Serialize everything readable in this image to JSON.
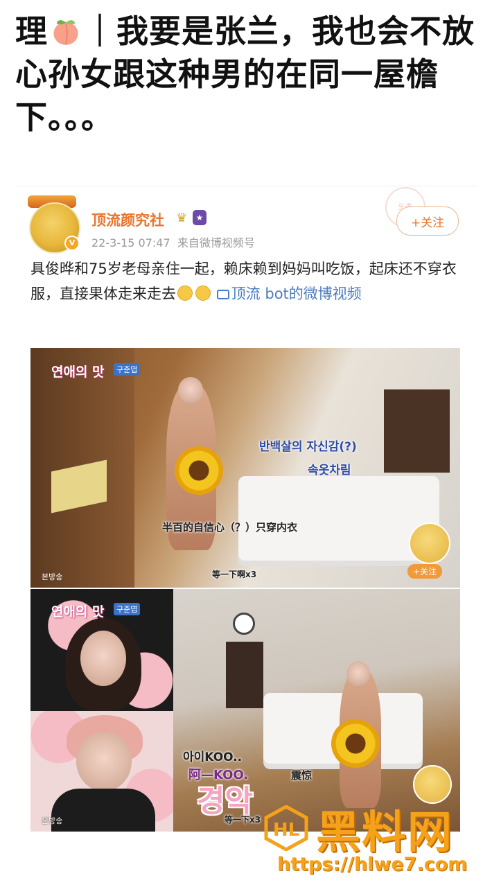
{
  "headline": {
    "part1": "理",
    "part2": "｜我要是张兰，我也会不放心孙女跟这种男的在同一屋檐下。。。"
  },
  "post": {
    "username": "顶流颜究社",
    "date": "22-3-15 07:47",
    "source": "来自微博视频号",
    "follow_label": "+关注",
    "stamp_text": "头条",
    "text_main": "具俊晔和75岁老母亲住一起，赖床赖到妈妈叫吃饭，起床还不穿衣服，直接果体走来走去",
    "link_text": "顶流 bot的微博视频"
  },
  "frame1": {
    "show_title": "연애의 맛",
    "show_tag": "구준엽",
    "caption_kr_1": "반백살의 자신감(?)",
    "caption_kr_2": "속옷차림",
    "caption_cn": "半百的自信心（？）只穿内衣",
    "caption_wait": "等一下啊x3",
    "broadcast": "본방송",
    "mascot_follow": "+关注"
  },
  "frame2": {
    "show_title": "연애의 맛",
    "show_tag": "구준엽",
    "caption_small": "아이KOO..",
    "caption_cn_name": "阿—KOO.",
    "caption_cn_shock": "震惊",
    "big_kr": "경악",
    "caption_wait": "等一下x3",
    "broadcast": "본방송"
  },
  "watermark": {
    "brand": "黑料网",
    "url": "https://hlwe7.com",
    "logo_letters": "HL"
  },
  "colors": {
    "accent": "#e9752c",
    "link": "#4b7cc0",
    "watermark": "#f5a21a"
  }
}
